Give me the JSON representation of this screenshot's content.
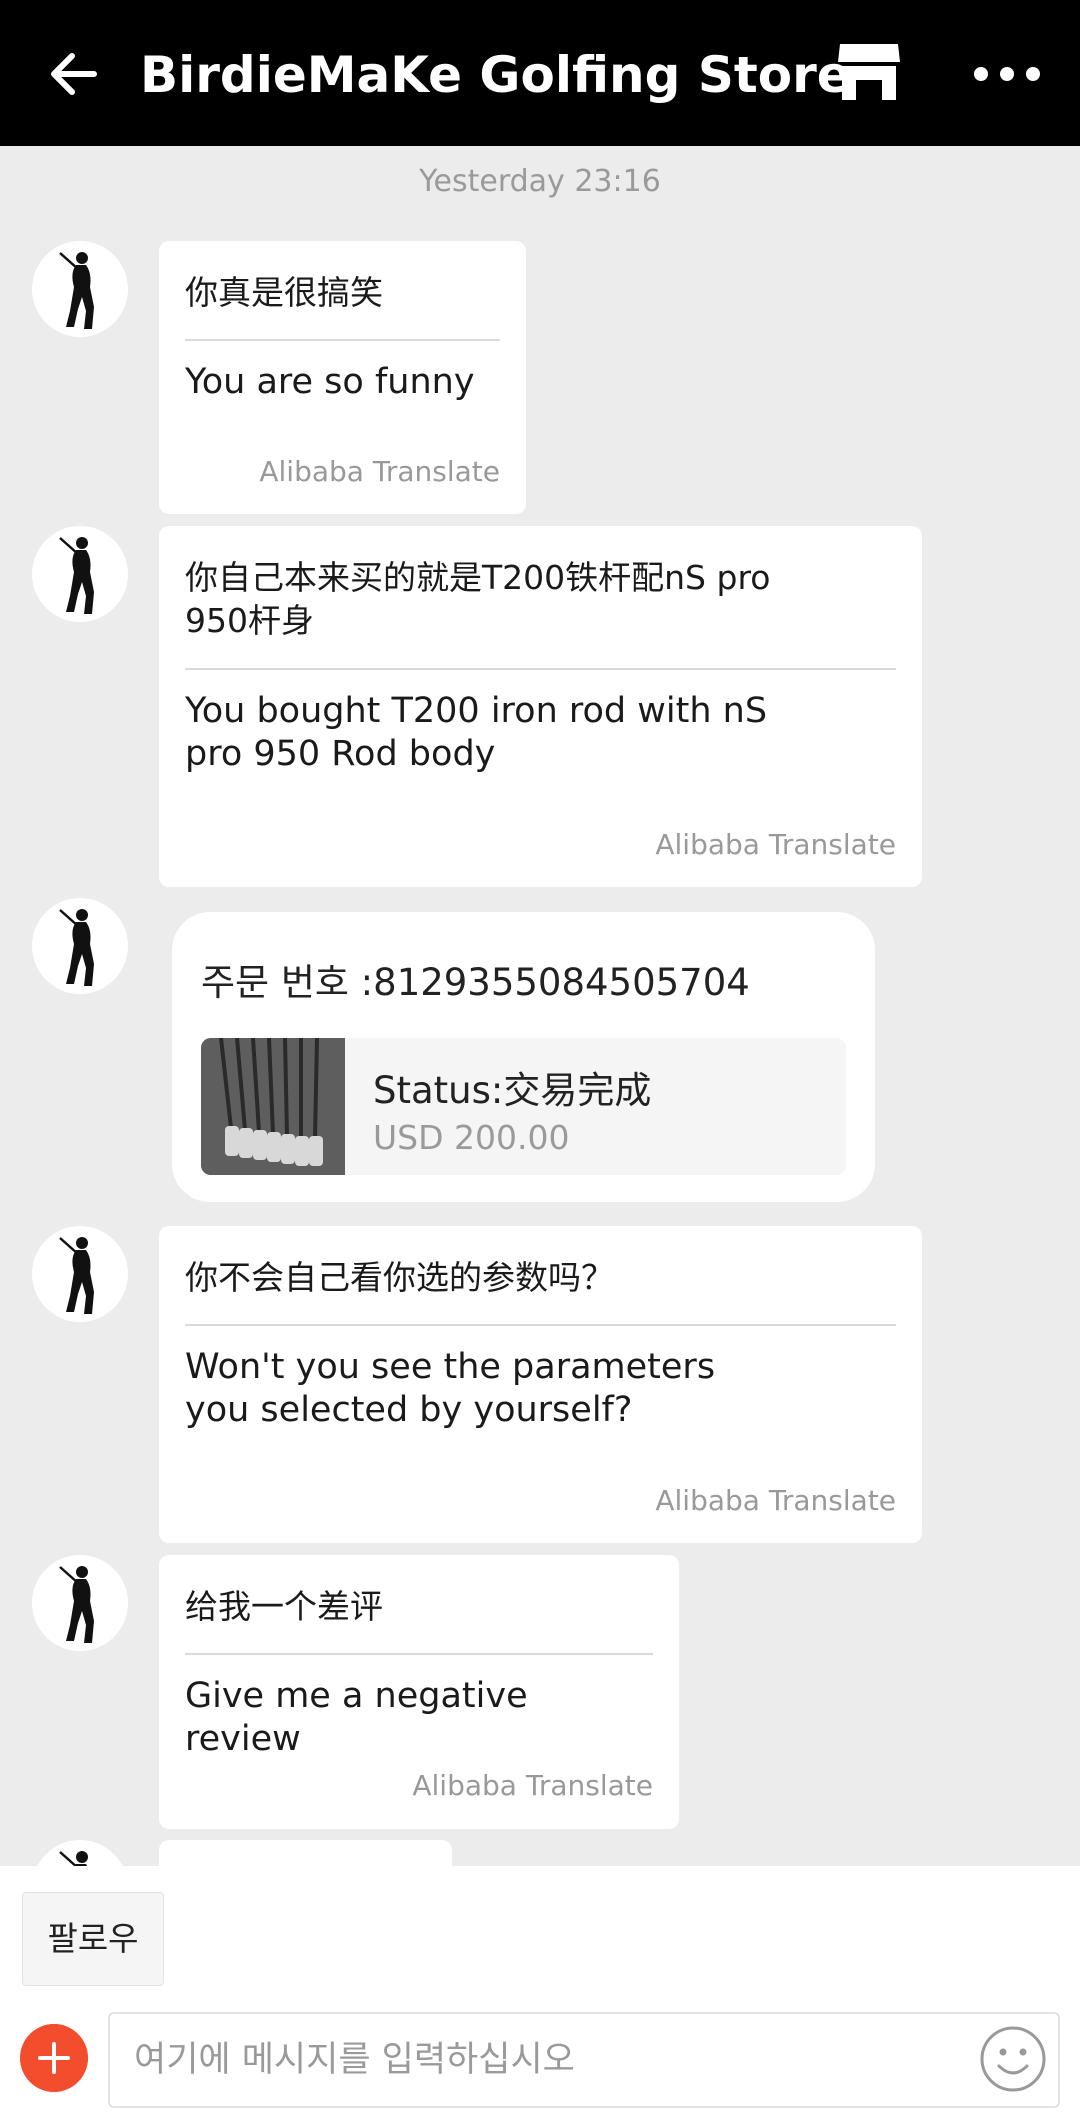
{
  "header": {
    "title": "BirdieMaKe Golfing Store",
    "back_icon": "arrow-left-icon",
    "store_icon": "store-icon",
    "more_icon": "more-dots-icon"
  },
  "timestamp": "Yesterday 23:16",
  "messages": [
    {
      "original": "你真是很搞笑",
      "translation": "You are so funny",
      "attribution": "Alibaba Translate"
    },
    {
      "original": "你自己本来买的就是T200铁杆配nS pro 950杆身",
      "translation": "You bought T200 iron rod with nS pro 950 Rod body",
      "attribution": "Alibaba Translate"
    },
    {
      "original": "你不会自己看你选的参数吗？",
      "translation": "Won't you see the parameters you selected by yourself?",
      "attribution": "Alibaba Translate"
    },
    {
      "original": "给我一个差评",
      "translation": "Give me a negative review",
      "attribution": "Alibaba Translate"
    }
  ],
  "order": {
    "number_label": "주문 번호 :8129355084505704",
    "status": "Status:交易完成",
    "price": "USD 200.00"
  },
  "footer": {
    "follow_label": "팔로우",
    "input_placeholder": "여기에 메시지를 입력하십시오",
    "plus_icon": "plus-icon",
    "emoji_icon": "smiley-icon"
  },
  "colors": {
    "header_bg": "#000000",
    "chat_bg": "#ececec",
    "accent": "#f24e2e"
  }
}
